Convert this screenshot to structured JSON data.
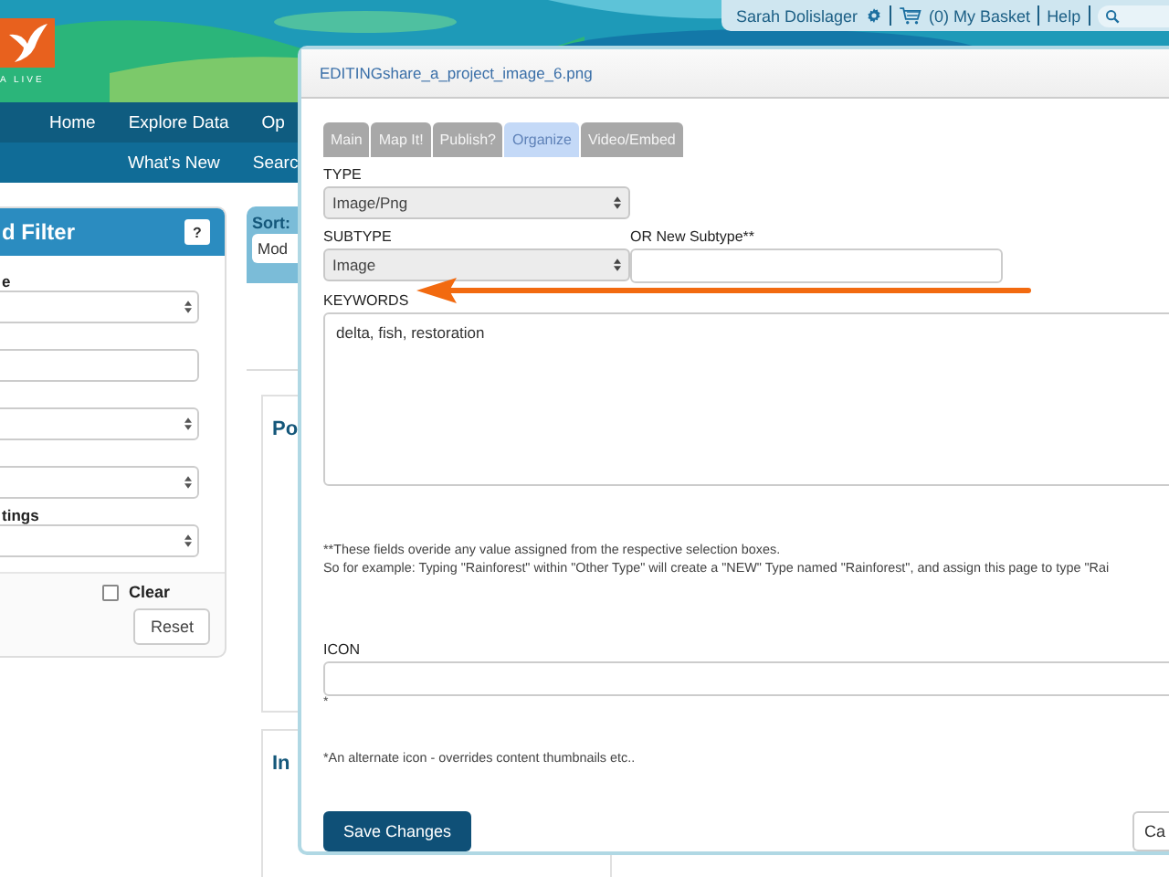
{
  "header": {
    "logo_text": "A LIVE",
    "user": "Sarah Dolislager",
    "basket": "(0) My Basket",
    "help": "Help"
  },
  "nav": {
    "primary": [
      "Home",
      "Explore Data",
      "Op"
    ],
    "secondary": [
      "What's New",
      "Searc"
    ]
  },
  "filter_panel": {
    "title": "d Filter",
    "help": "?",
    "fields": [
      {
        "kind": "select",
        "label": "e"
      },
      {
        "kind": "input"
      },
      {
        "kind": "select"
      },
      {
        "kind": "select"
      },
      {
        "kind": "select",
        "label": "tings"
      }
    ],
    "clear": {
      "label": "Clear",
      "checked": false
    },
    "reset": "Reset"
  },
  "results": {
    "sort_label": "Sort:",
    "sort_value": "Mod",
    "cards": [
      "Po",
      "In"
    ]
  },
  "dialog": {
    "title": "EDITINGshare_a_project_image_6.png",
    "tabs": [
      {
        "label": "Main",
        "selected": false
      },
      {
        "label": "Map It!",
        "selected": false
      },
      {
        "label": "Publish?",
        "selected": false
      },
      {
        "label": "Organize",
        "selected": true
      },
      {
        "label": "Video/Embed",
        "selected": false
      }
    ],
    "type": {
      "label": "TYPE",
      "value": "Image/Png"
    },
    "subtype": {
      "label": "SUBTYPE",
      "value": "Image"
    },
    "new_subtype": {
      "label": "OR New Subtype**"
    },
    "keywords": {
      "label": "KEYWORDS",
      "value": "delta, fish, restoration"
    },
    "notes": [
      "**These fields overide any value assigned from the respective selection boxes.",
      "So for example: Typing \"Rainforest\" within \"Other Type\" will create a \"NEW\" Type named \"Rainforest\", and assign this page to type \"Rai"
    ],
    "icon": {
      "label": "ICON",
      "hint": "*"
    },
    "icon_note": "*An alternate icon - overrides content thumbnails etc..",
    "save": "Save Changes",
    "cancel": "Ca"
  }
}
